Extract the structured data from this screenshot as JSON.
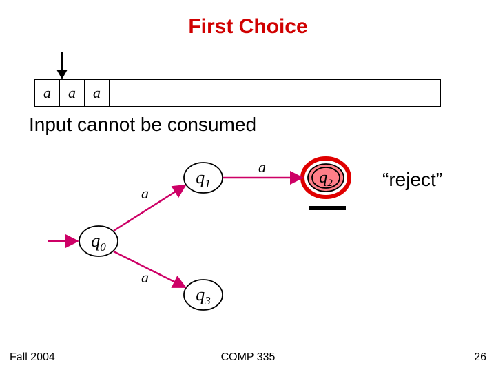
{
  "title": "First Choice",
  "subtitle": "Input cannot be consumed",
  "reject_label": "“reject”",
  "tape": {
    "cells": [
      "a",
      "a",
      "a"
    ]
  },
  "states": {
    "q0": {
      "label": "q",
      "sub": "0"
    },
    "q1": {
      "label": "q",
      "sub": "1"
    },
    "q2": {
      "label": "q",
      "sub": "2"
    },
    "q3": {
      "label": "q",
      "sub": "3"
    }
  },
  "edges": {
    "q0_q1": "a",
    "q0_q3": "a",
    "q1_q2": "a"
  },
  "footer": {
    "left": "Fall 2004",
    "center": "COMP 335",
    "right": "26"
  },
  "chart_data": {
    "type": "table",
    "title": "NFA transition diagram (First Choice branch)",
    "tape_input": [
      "a",
      "a",
      "a"
    ],
    "tape_head_position": 1,
    "states": [
      "q0",
      "q1",
      "q2",
      "q3"
    ],
    "start_state": "q0",
    "accepting_states": [
      "q2"
    ],
    "highlighted_state": "q2",
    "transitions": [
      {
        "from": "q0",
        "to": "q1",
        "symbol": "a"
      },
      {
        "from": "q0",
        "to": "q3",
        "symbol": "a"
      },
      {
        "from": "q1",
        "to": "q2",
        "symbol": "a"
      }
    ],
    "result": "reject",
    "note": "Input cannot be consumed"
  }
}
